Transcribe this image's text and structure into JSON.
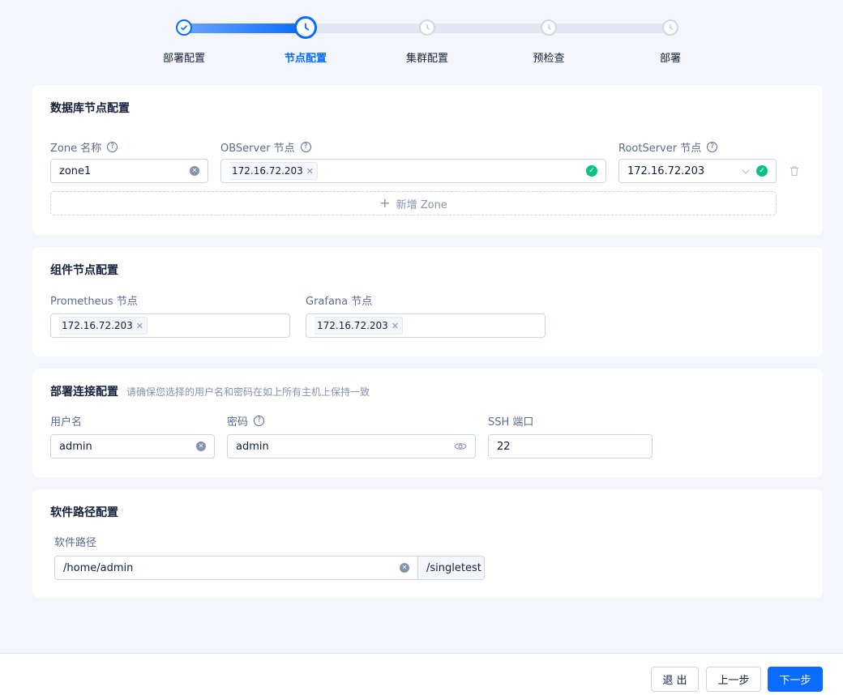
{
  "steps": [
    {
      "label": "部署配置",
      "state": "done"
    },
    {
      "label": "节点配置",
      "state": "current"
    },
    {
      "label": "集群配置",
      "state": "pending"
    },
    {
      "label": "预检查",
      "state": "pending"
    },
    {
      "label": "部署",
      "state": "pending"
    }
  ],
  "db_nodes": {
    "title": "数据库节点配置",
    "zone_label": "Zone 名称",
    "observer_label": "OBServer 节点",
    "rootserver_label": "RootServer 节点",
    "zone_value": "zone1",
    "observer_tag": "172.16.72.203",
    "rootserver_value": "172.16.72.203",
    "add_zone_label": "新增 Zone"
  },
  "components": {
    "title": "组件节点配置",
    "prometheus_label": "Prometheus 节点",
    "prometheus_tag": "172.16.72.203",
    "grafana_label": "Grafana 节点",
    "grafana_tag": "172.16.72.203"
  },
  "connection": {
    "title": "部署连接配置",
    "hint": "请确保您选择的用户名和密码在如上所有主机上保持一致",
    "username_label": "用户名",
    "username_value": "admin",
    "password_label": "密码",
    "password_value": "admin",
    "ssh_label": "SSH 端口",
    "ssh_value": "22"
  },
  "software": {
    "title": "软件路径配置",
    "path_label": "软件路径",
    "path_value": "/home/admin",
    "path_suffix": "/singletest"
  },
  "footer": {
    "exit_label": "退 出",
    "prev_label": "上一步",
    "next_label": "下一步"
  },
  "colors": {
    "primary": "#0a6cff",
    "success": "#0ac185",
    "background": "#f4f6fb",
    "muted": "#8592ad"
  }
}
